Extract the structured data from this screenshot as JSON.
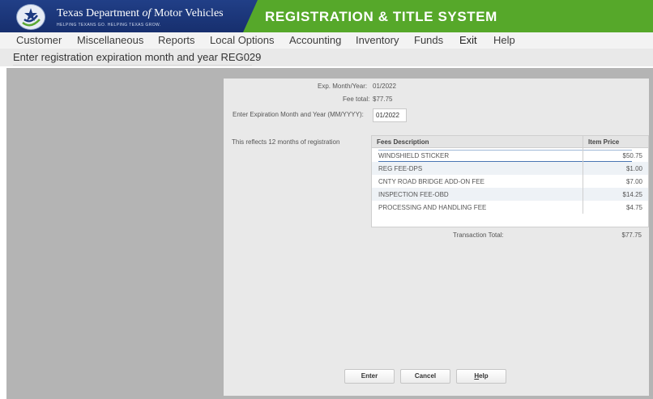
{
  "header": {
    "agency_name_pre": "Texas Department ",
    "agency_name_of": "of",
    "agency_name_post": " Motor Vehicles",
    "tagline": "HELPING TEXANS GO. HELPING TEXAS GROW.",
    "system_title": "REGISTRATION & TITLE SYSTEM",
    "logo_icon": "texas-star-logo-icon",
    "colors": {
      "blue": "#1c3a80",
      "green": "#56a82a"
    }
  },
  "menu": {
    "items": [
      "Customer",
      "Miscellaneous",
      "Reports",
      "Local Options",
      "Accounting",
      "Inventory",
      "Funds",
      "Exit",
      "Help"
    ]
  },
  "screen": {
    "title": "Enter registration expiration month and year REG029"
  },
  "form": {
    "exp_label": "Exp. Month/Year:",
    "exp_value": "01/2022",
    "fee_total_label": "Fee total:",
    "fee_total_value": "$77.75",
    "entry_label": "Enter Expiration Month and Year (MM/YYYY):",
    "entry_value": "01/2022",
    "reflects_text": "This reflects 12 months of registration"
  },
  "fees_table": {
    "headers": {
      "description": "Fees Description",
      "price": "Item Price"
    },
    "rows": [
      {
        "description": "WINDSHIELD STICKER",
        "price": "$50.75"
      },
      {
        "description": "REG FEE-DPS",
        "price": "$1.00"
      },
      {
        "description": "CNTY ROAD BRIDGE ADD-ON FEE",
        "price": "$7.00"
      },
      {
        "description": "INSPECTION FEE-OBD",
        "price": "$14.25"
      },
      {
        "description": "PROCESSING AND HANDLING FEE",
        "price": "$4.75"
      }
    ],
    "total_label": "Transaction Total:",
    "total_value": "$77.75"
  },
  "buttons": {
    "enter": "Enter",
    "cancel": "Cancel",
    "help_underlined": "H",
    "help_rest": "elp"
  }
}
